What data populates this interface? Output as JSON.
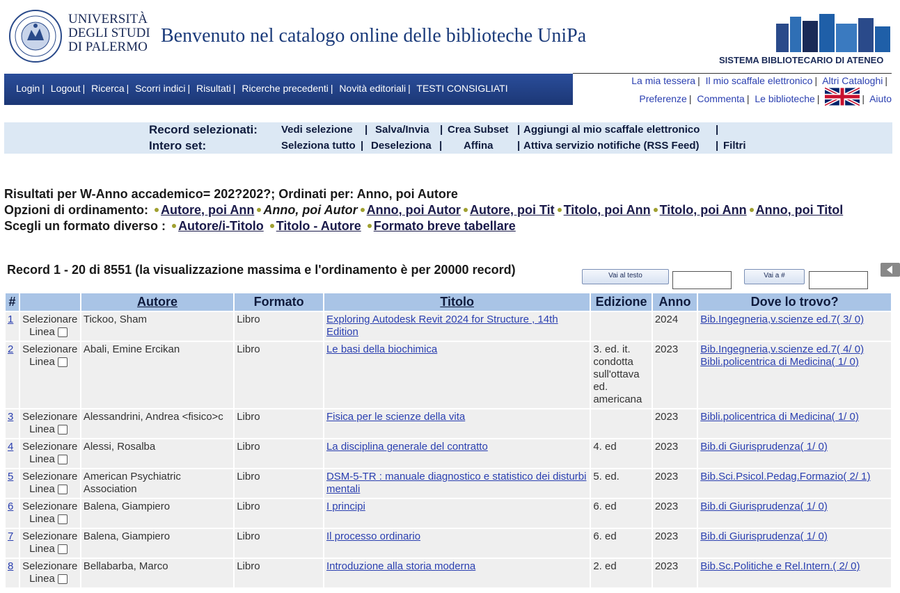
{
  "header": {
    "university_lines": [
      "UNIVERSITÀ",
      "DEGLI STUDI",
      "DI PALERMO"
    ],
    "welcome_title": "Benvenuto nel catalogo online delle biblioteche UniPa",
    "sba_label": "SISTEMA BIBLIOTECARIO DI ATENEO"
  },
  "nav": {
    "items": [
      "Login",
      "Logout",
      "Ricerca",
      "Scorri indici",
      "Risultati",
      "Ricerche precedenti",
      "Novità editoriali",
      "TESTI CONSIGLIATI"
    ]
  },
  "right_links": {
    "row1": [
      "La mia tessera",
      "Il mio scaffale elettronico",
      "Altri Cataloghi"
    ],
    "row2": [
      "Preferenze",
      "Commenta",
      "Le biblioteche"
    ],
    "help": "Aiuto"
  },
  "selection_bar": {
    "record_label": "Record selezionati:",
    "set_label": "Intero set:",
    "record_actions": [
      "Vedi selezione",
      "Salva/Invia",
      "Crea Subset",
      "Aggiungi al mio scaffale elettronico"
    ],
    "set_actions": [
      "Seleziona tutto",
      "Deseleziona",
      "Affina",
      "Attiva servizio notifiche (RSS Feed)",
      "Filtri"
    ]
  },
  "results": {
    "summary": "Risultati per W-Anno accademico= 202?202?; Ordinati per: Anno, poi Autore",
    "sort_label": "Opzioni di ordinamento:",
    "sort_options": [
      "Autore, poi Ann",
      "Anno, poi Autor",
      "Anno, poi Autor",
      "Autore, poi Tit",
      "Titolo, poi Ann",
      "Titolo, poi Ann",
      "Anno, poi Titol"
    ],
    "format_label": "Scegli un formato diverso :",
    "format_options": [
      "Autore/i-Titolo",
      "Titolo - Autore",
      "Formato breve tabellare"
    ],
    "record_count": "Record 1 - 20 di 8551 (la visualizzazione massima e l'ordinamento è per 20000 record)",
    "goto_text_button": "Vai al testo",
    "goto_num_button": "Vai a #"
  },
  "table": {
    "headers": [
      "#",
      "",
      "Autore",
      "Formato",
      "Titolo",
      "Edizione",
      "Anno",
      "Dove lo trovo?"
    ],
    "select_label": "Selezionare",
    "select_label2": "Linea",
    "rows": [
      {
        "num": "1",
        "author": "Tickoo, Sham",
        "format": "Libro",
        "title": "Exploring Autodesk Revit 2024 for Structure , 14th Edition",
        "edition": "",
        "year": "2024",
        "locations": [
          "Bib.Ingegneria,v.scienze ed.7( 3/ 0)"
        ]
      },
      {
        "num": "2",
        "author": "Abali, Emine Ercikan",
        "format": "Libro",
        "title": "Le basi della biochimica",
        "edition": "3. ed. it. condotta sull'ottava ed. americana",
        "year": "2023",
        "locations": [
          "Bib.Ingegneria,v.scienze ed.7( 4/ 0)",
          "Bibli.policentrica di Medicina( 1/ 0)"
        ]
      },
      {
        "num": "3",
        "author": "Alessandrini, Andrea <fisico>c",
        "format": "Libro",
        "title": "Fisica per le scienze della vita",
        "edition": "",
        "year": "2023",
        "locations": [
          "Bibli.policentrica di Medicina( 1/ 0)"
        ]
      },
      {
        "num": "4",
        "author": "Alessi, Rosalba",
        "format": "Libro",
        "title": "La disciplina generale del contratto",
        "edition": "4. ed",
        "year": "2023",
        "locations": [
          "Bib.di Giurisprudenza( 1/ 0)"
        ]
      },
      {
        "num": "5",
        "author": "American Psychiatric Association",
        "format": "Libro",
        "title": "DSM-5-TR : manuale diagnostico e statistico dei disturbi mentali",
        "edition": "5. ed.",
        "year": "2023",
        "locations": [
          "Bib.Sci.Psicol.Pedag.Formazio( 2/ 1)"
        ]
      },
      {
        "num": "6",
        "author": "Balena, Giampiero",
        "format": "Libro",
        "title": "I principi",
        "edition": "6. ed",
        "year": "2023",
        "locations": [
          "Bib.di Giurisprudenza( 1/ 0)"
        ]
      },
      {
        "num": "7",
        "author": "Balena, Giampiero",
        "format": "Libro",
        "title": "Il processo ordinario",
        "edition": "6. ed",
        "year": "2023",
        "locations": [
          "Bib.di Giurisprudenza( 1/ 0)"
        ]
      },
      {
        "num": "8",
        "author": "Bellabarba, Marco",
        "format": "Libro",
        "title": "Introduzione alla storia moderna",
        "edition": "2. ed",
        "year": "2023",
        "locations": [
          "Bib.Sc.Politiche e Rel.Intern.( 2/ 0)"
        ]
      }
    ]
  }
}
